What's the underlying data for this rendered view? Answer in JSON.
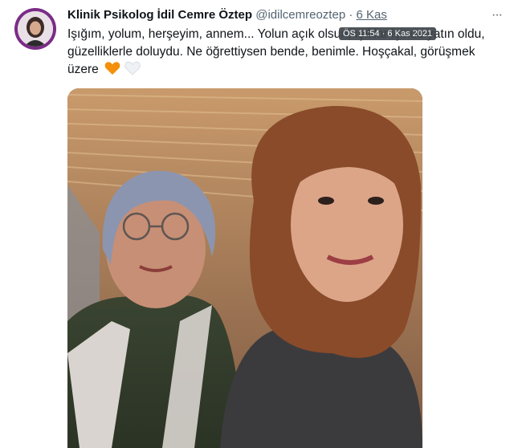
{
  "author": {
    "display_name": "Klinik Psikolog İdil Cemre Öztep",
    "handle": "@idilcemreoztep",
    "separator": "·",
    "date": "6 Kas"
  },
  "tweet": {
    "text": "Işığım, yolum, herşeyim, annem... Yolun açık olsun, ışıklar içinde yatın oldu, güzelliklerle doluydu. Ne öğrettiysen bende, benimle. Hoşçakal, görüşmek üzere"
  },
  "tooltip": {
    "text": "ÖS 11:54 · 6 Kas 2021"
  },
  "menu": {
    "more_label": "···"
  },
  "icons": {
    "avatar": "profile-avatar",
    "more": "more-icon",
    "orange_heart": "orange-heart-icon",
    "white_heart": "white-heart-icon"
  },
  "colors": {
    "avatar_ring": "#7a2c86",
    "heart_orange": "#f4900c",
    "heart_white": "#eef2f6",
    "muted_text": "#536471",
    "tooltip_bg": "#3f464c"
  }
}
